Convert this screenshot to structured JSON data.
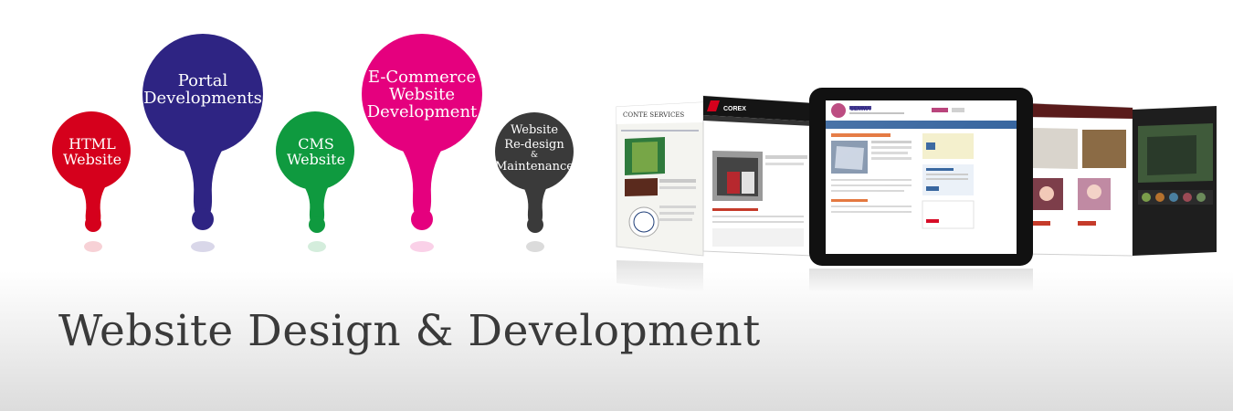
{
  "bubbles": {
    "html": {
      "line1": "HTML",
      "line2": "Website",
      "color": "#d5001c"
    },
    "portal": {
      "line1": "Portal",
      "line2": "Developments",
      "color": "#2e2483"
    },
    "cms": {
      "line1": "CMS",
      "line2": "Website",
      "color": "#0f9a3f"
    },
    "ecommerce": {
      "line1": "E-Commerce",
      "line2": "Website",
      "line3": "Development",
      "color": "#e5007e"
    },
    "redesign": {
      "line1": "Website",
      "line2": "Re-design",
      "amp": "&",
      "line3": "Maintenance",
      "color": "#3a3a3a"
    }
  },
  "screens": {
    "conte": {
      "title": "CONTE SERVICES"
    },
    "corex": {
      "title": "COREX"
    },
    "semma": {
      "title": "SEMMA"
    }
  },
  "headline": "Website Design & Development"
}
